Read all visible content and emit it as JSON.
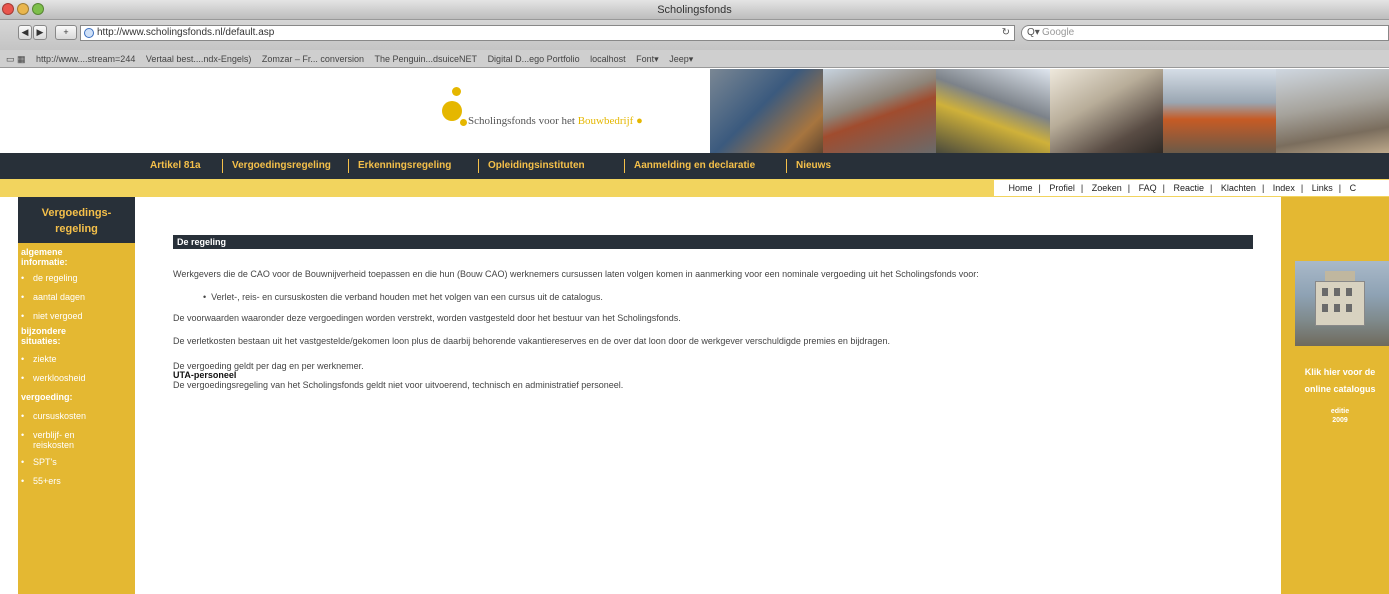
{
  "browser": {
    "title": "Scholingsfonds",
    "url": "http://www.scholingsfonds.nl/default.asp",
    "search_placeholder": "Google",
    "bookmarks": [
      "http://www....stream=244",
      "Vertaal best....ndx-Engels)",
      "Zomzar – Fr... conversion",
      "The Penguin...dsuiceNET",
      "Digital D...ego Portfolio",
      "localhost",
      "Font▾",
      "Jeep▾"
    ]
  },
  "header": {
    "logo_text": "Scholingsfonds voor het",
    "logo_accent": "Bouwbedrijf"
  },
  "mainnav": [
    "Artikel 81a",
    "Vergoedingsregeling",
    "Erkenningsregeling",
    "Opleidingsinstituten",
    "Aanmelding en declaratie",
    "Nieuws"
  ],
  "utility_nav": [
    "Home",
    "Profiel",
    "Zoeken",
    "FAQ",
    "Reactie",
    "Klachten",
    "Index",
    "Links",
    "C"
  ],
  "sidebar": {
    "title": "Vergoedings-regeling",
    "sections": [
      {
        "heading": "algemene informatie:",
        "items": [
          "de regeling",
          "aantal dagen",
          "niet vergoed"
        ]
      },
      {
        "heading": "bijzondere situaties:",
        "items": [
          "ziekte",
          "werkloosheid"
        ]
      },
      {
        "heading": "vergoeding:",
        "items": [
          "cursuskosten",
          "verblijf- en reiskosten",
          "SPT's",
          "55+ers"
        ]
      }
    ]
  },
  "content": {
    "section_title": "De regeling",
    "intro": "Werkgevers die de CAO voor de Bouwnijverheid toepassen en die hun (Bouw CAO) werknemers cursussen laten volgen komen in aanmerking voor een nominale vergoeding uit het Scholingsfonds voor:",
    "bullet": "Verlet-, reis- en cursuskosten die verband houden met het volgen van een cursus uit de catalogus.",
    "p2": "De voorwaarden waaronder deze vergoedingen worden verstrekt, worden vastgesteld door het bestuur van het Scholingsfonds.",
    "p3": "De verletkosten bestaan uit het vastgestelde/gekomen loon plus de daarbij behorende vakantiereserves en de over dat loon door de werkgever verschuldigde premies en bijdragen.",
    "p4": "De vergoeding geldt per dag en per werknemer.",
    "uta_heading": "UTA-personeel",
    "uta_text": "De vergoedingsregeling van het Scholingsfonds geldt niet voor uitvoerend, technisch en administratief personeel."
  },
  "catalogus": {
    "link_text": "Klik hier voor de online catalogus",
    "edition_label": "editie",
    "edition_year": "2009"
  },
  "colors": {
    "accent": "#e5b700",
    "navbar": "#283039",
    "sidebar": "#e4b832",
    "navtext": "#f5c04a"
  }
}
